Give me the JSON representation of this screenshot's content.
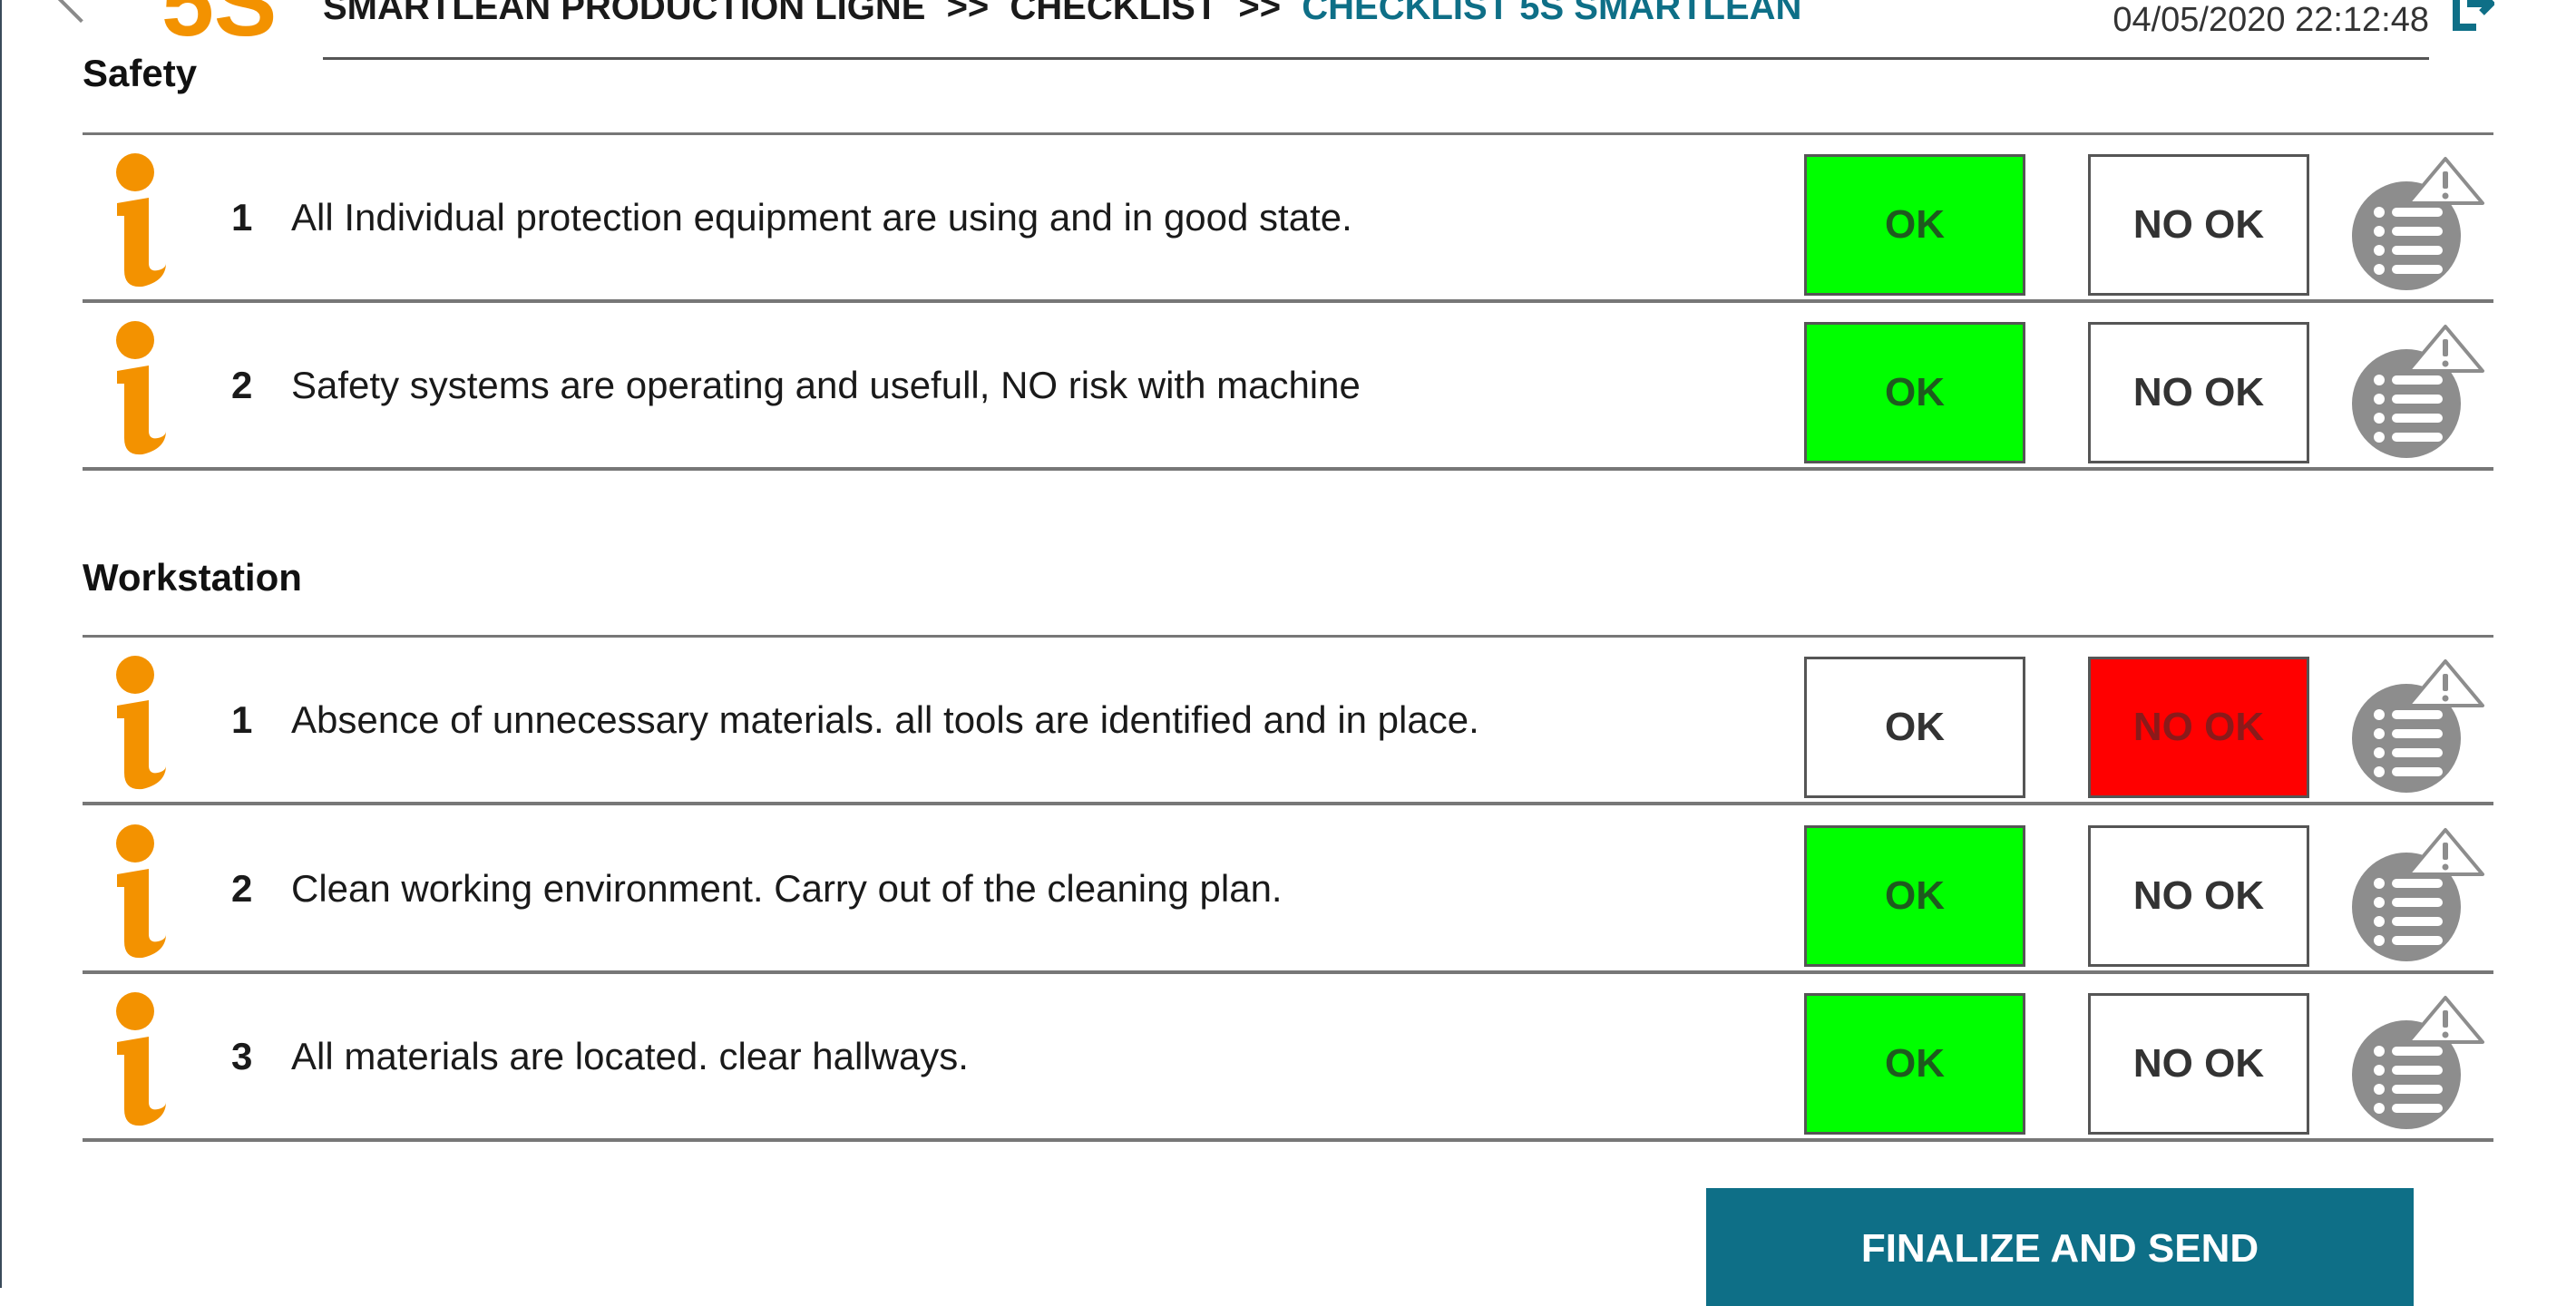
{
  "header": {
    "logo": "5S",
    "breadcrumb": [
      {
        "label": "SMARTLEAN PRODUCTION LIGNE"
      },
      {
        "label": "CHECKLIST"
      },
      {
        "label": "CHECKLIST 5S SMARTLEAN"
      }
    ],
    "separator": ">>",
    "datetime": "04/05/2020 22:12:48"
  },
  "buttons": {
    "ok_label": "OK",
    "nok_label": "NO OK"
  },
  "colors": {
    "ok_selected": "#00ff00",
    "nok_selected": "#ff0000",
    "accent": "#0e6f87",
    "info_icon": "#f39200"
  },
  "sections": [
    {
      "title": "Safety",
      "items": [
        {
          "number": "1",
          "text": "All Individual protection equipment are using and in good state.",
          "status": "OK"
        },
        {
          "number": "2",
          "text": "Safety systems are operating and usefull, NO risk with machine",
          "status": "OK"
        }
      ]
    },
    {
      "title": "Workstation",
      "items": [
        {
          "number": "1",
          "text": "Absence of unnecessary materials. all tools are identified and in place.",
          "status": "NO OK"
        },
        {
          "number": "2",
          "text": "Clean working environment. Carry out of the cleaning plan.",
          "status": "OK"
        },
        {
          "number": "3",
          "text": "All materials are located. clear hallways.",
          "status": "OK"
        }
      ]
    }
  ],
  "footer": {
    "finalize_label": "FINALIZE AND SEND"
  }
}
